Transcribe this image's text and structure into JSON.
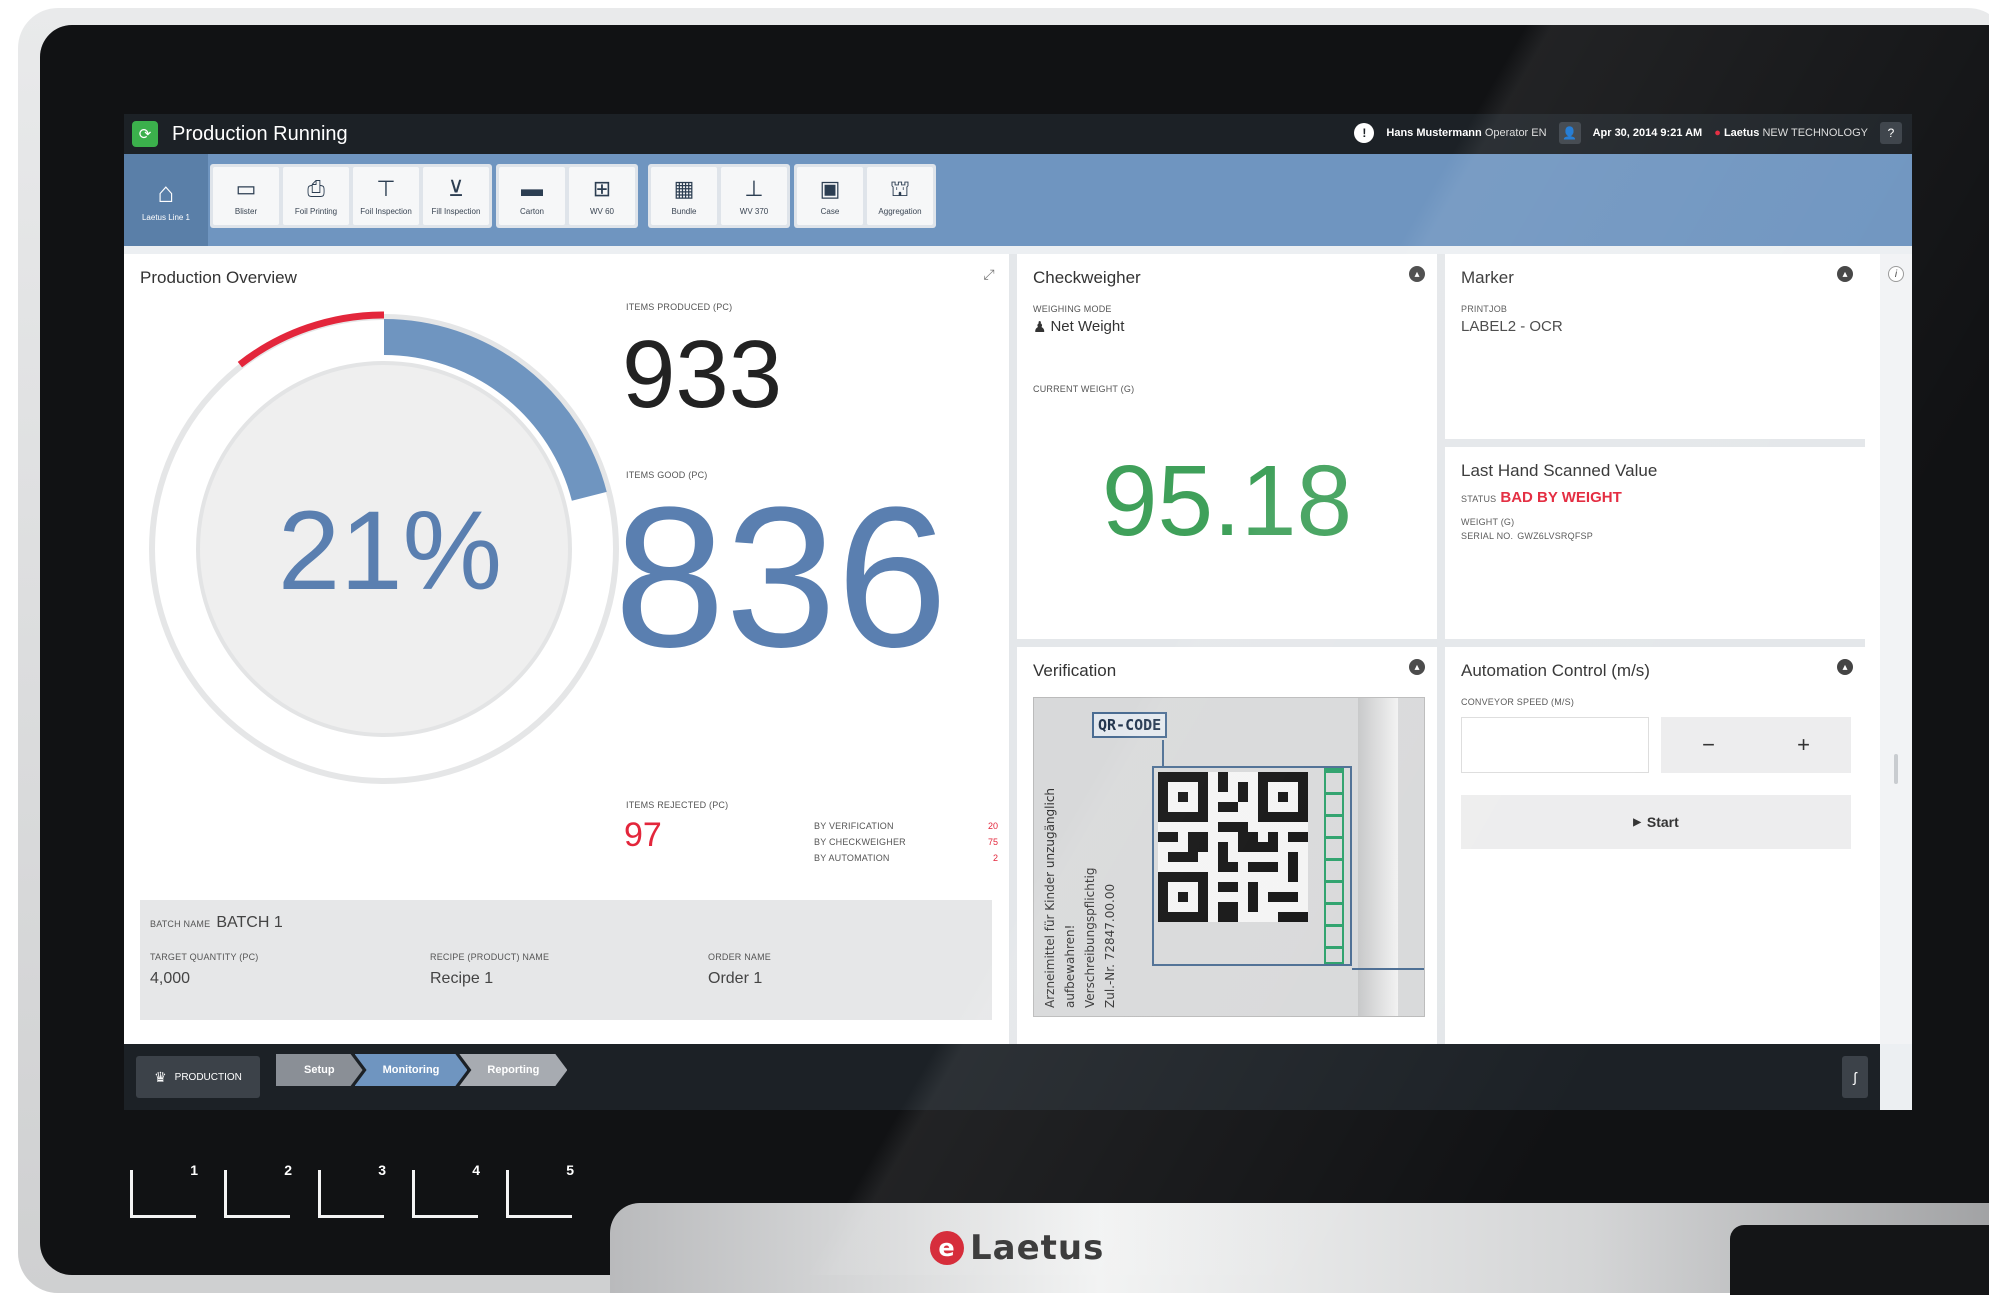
{
  "app": {
    "title": "Production Running",
    "user": "Hans Mustermann",
    "role": "Operator EN",
    "datetime": "Apr 30, 2014 9:21 AM",
    "brand": "Laetus",
    "brand_tagline": "NEW TECHNOLOGY",
    "help": "?"
  },
  "toolbar": {
    "home_label": "Laetus Line 1",
    "groups": [
      {
        "items": [
          {
            "label": "Blister"
          },
          {
            "label": "Foil Printing"
          },
          {
            "label": "Foil Inspection"
          },
          {
            "label": "Fill Inspection"
          }
        ]
      },
      {
        "items": [
          {
            "label": "Carton"
          },
          {
            "label": "WV 60"
          }
        ]
      },
      {
        "items": [
          {
            "label": "Bundle"
          },
          {
            "label": "WV 370"
          }
        ]
      },
      {
        "items": [
          {
            "label": "Case"
          },
          {
            "label": "Aggregation"
          }
        ]
      }
    ]
  },
  "overview": {
    "title": "Production Overview",
    "progress_text": "21%",
    "progress_fraction": 0.21,
    "items_produced_label": "Items Produced (pc)",
    "items_produced": "933",
    "items_good_label": "Items Good (pc)",
    "items_good": "836",
    "items_rejected_label": "Items Rejected (pc)",
    "items_rejected": "97",
    "reject_breakdown": [
      {
        "label": "By Verification",
        "value": "20"
      },
      {
        "label": "By Checkweigher",
        "value": "75"
      },
      {
        "label": "By Automation",
        "value": "2"
      }
    ],
    "batch_name_label": "Batch Name",
    "batch_name": "BATCH 1",
    "target_qty_label": "Target Quantity (pc)",
    "target_qty": "4,000",
    "recipe_label": "Recipe (Product) Name",
    "recipe": "Recipe 1",
    "order_label": "Order Name",
    "order": "Order 1",
    "colors": {
      "progress": "#6f95c0",
      "alarm": "#e3263b",
      "track": "#e5e6e7"
    }
  },
  "checkweigher": {
    "title": "Checkweigher",
    "mode_label": "Weighing Mode",
    "mode": "Net Weight",
    "weight_label": "Current Weight (g)",
    "weight": "95.18",
    "color": "#3fa05a"
  },
  "marker": {
    "title": "Marker",
    "printjob_label": "Printjob",
    "printjob": "LABEL2 - OCR"
  },
  "last_scan": {
    "title": "Last Hand Scanned Value",
    "status_label": "Status",
    "status": "BAD BY WEIGHT",
    "weight_label": "Weight (g)",
    "serial_label": "Serial No.",
    "serial": "GWZ6LVSRQFSP",
    "color": "#e3263b"
  },
  "verification": {
    "title": "Verification",
    "tag": "QR-CODE",
    "package_text": [
      "Arzneimittel für Kinder unzugänglich",
      "aufbewahren!",
      "Verschreibungspflichtig",
      "Zul.-Nr. 72847.00.00"
    ]
  },
  "automation": {
    "title": "Automation Control (m/s)",
    "speed_label": "Conveyor Speed (m/s)",
    "speed_value": "",
    "minus": "−",
    "plus": "+",
    "start": "Start"
  },
  "bottom": {
    "production_label": "Production",
    "steps": [
      {
        "label": "Setup"
      },
      {
        "label": "Monitoring"
      },
      {
        "label": "Reporting"
      }
    ]
  },
  "device": {
    "brand": "Laetus",
    "keys": [
      "1",
      "2",
      "3",
      "4",
      "5"
    ]
  }
}
